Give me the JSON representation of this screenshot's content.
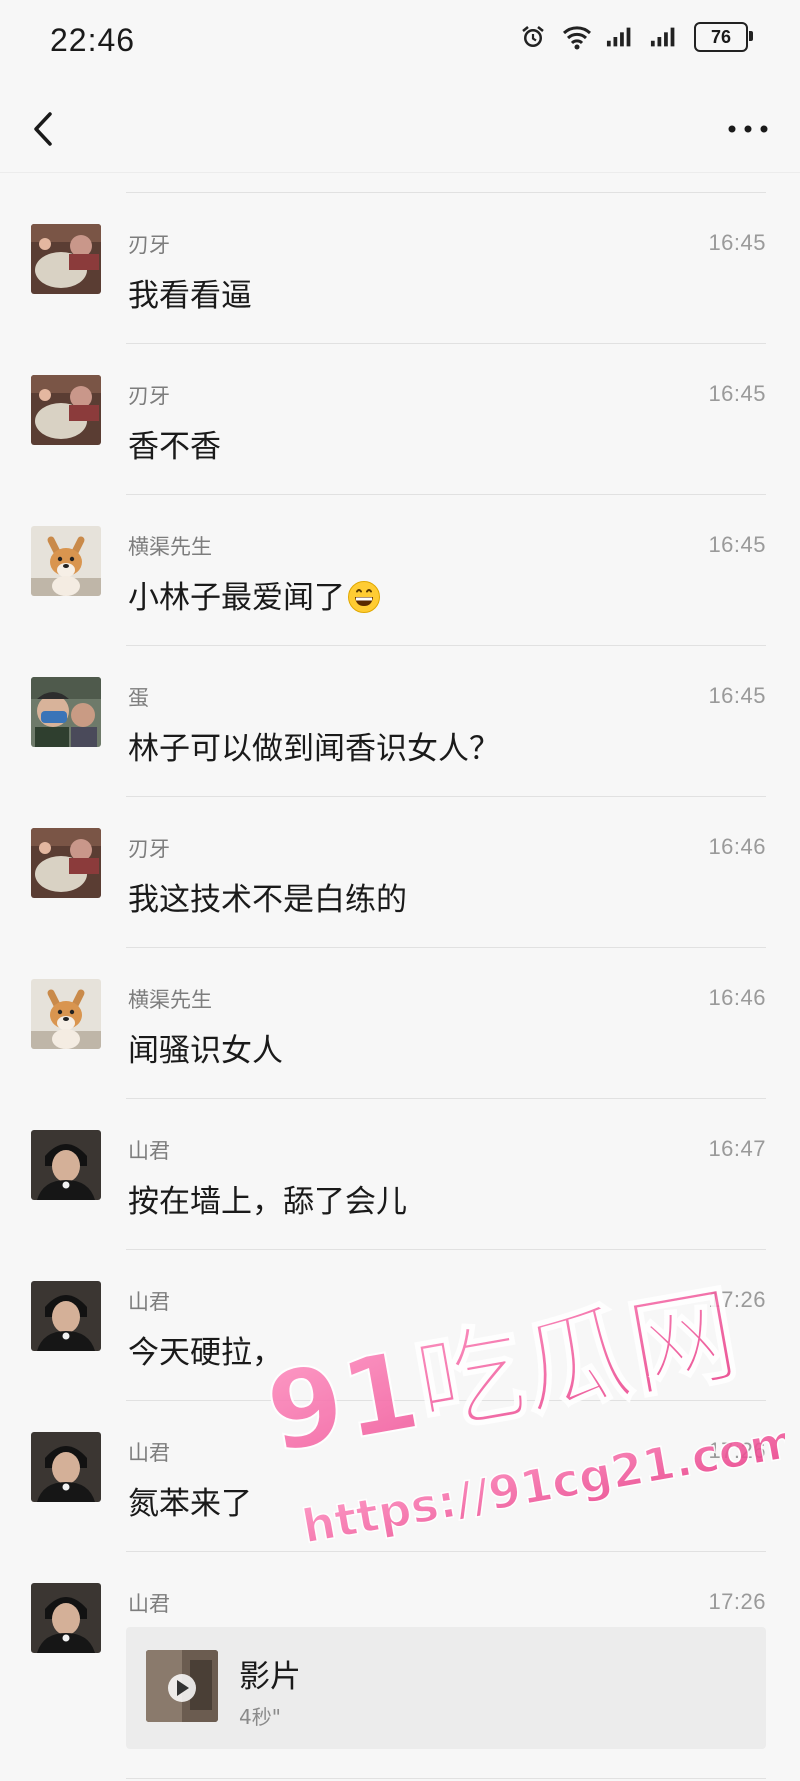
{
  "status_bar": {
    "time": "22:46",
    "battery": "76",
    "icons": [
      "alarm-icon",
      "wifi-icon",
      "signal-icon",
      "signal-icon"
    ]
  },
  "nav": {
    "back_icon": "chevron-left-icon",
    "more_icon": "more-dots-icon"
  },
  "messages": [
    {
      "sender": "刃牙",
      "time": "16:45",
      "text": "我看看逼",
      "avatar": "photo-avatar-renya"
    },
    {
      "sender": "刃牙",
      "time": "16:45",
      "text": "香不香",
      "avatar": "photo-avatar-renya"
    },
    {
      "sender": "横渠先生",
      "time": "16:45",
      "text": "小林子最爱闻了",
      "emoji": "grinning-face-emoji",
      "avatar": "dog-avatar"
    },
    {
      "sender": "蛋",
      "time": "16:45",
      "text": "林子可以做到闻香识女人？",
      "avatar": "photo-avatar-dan"
    },
    {
      "sender": "刃牙",
      "time": "16:46",
      "text": "我这技术不是白练的",
      "avatar": "photo-avatar-renya"
    },
    {
      "sender": "横渠先生",
      "time": "16:46",
      "text": "闻骚识女人",
      "avatar": "dog-avatar"
    },
    {
      "sender": "山君",
      "time": "16:47",
      "text": "按在墙上，舔了会儿",
      "avatar": "photo-avatar-shanjun"
    },
    {
      "sender": "山君",
      "time": "17:26",
      "text": "今天硬拉，",
      "avatar": "photo-avatar-shanjun"
    },
    {
      "sender": "山君",
      "time": "17:26",
      "text": "氮苯来了",
      "avatar": "photo-avatar-shanjun"
    },
    {
      "sender": "山君",
      "time": "17:26",
      "text": "",
      "avatar": "photo-avatar-shanjun"
    }
  ],
  "video": {
    "title": "影片",
    "duration": "4秒\"",
    "icon": "play-icon"
  },
  "watermark": {
    "brand": "91吃瓜网",
    "url": "https://91cg21.com",
    "color": "#f0579c"
  },
  "colors": {
    "background": "#f7f7f7",
    "divider": "#e1e1e1",
    "secondary_text": "#7d7d7d"
  }
}
